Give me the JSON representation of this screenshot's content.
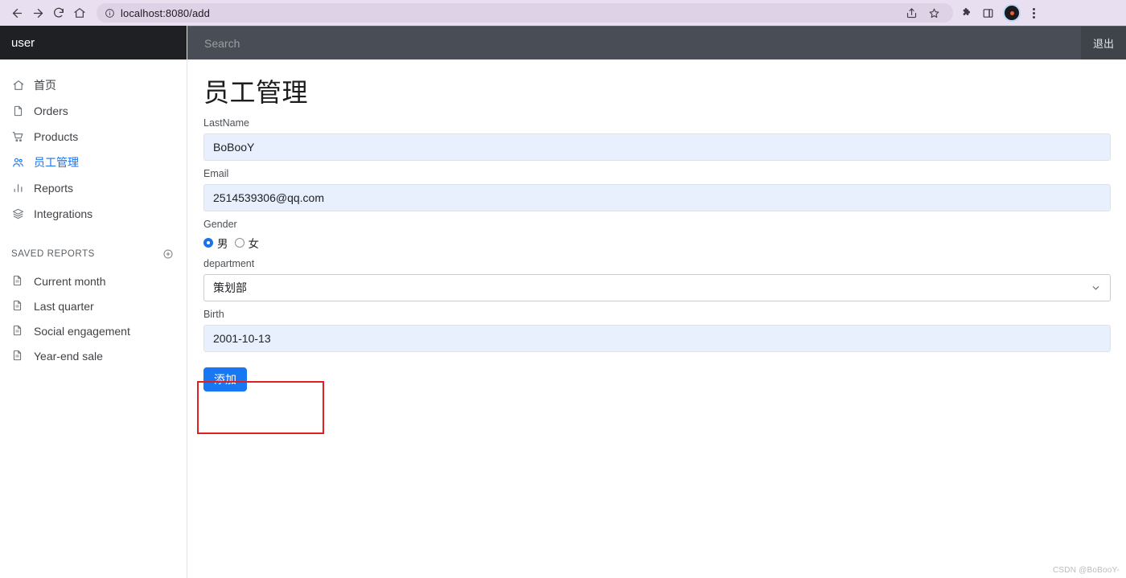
{
  "browser": {
    "url": "localhost:8080/add",
    "back_icon": "back-arrow-icon",
    "forward_icon": "forward-arrow-icon",
    "reload_icon": "reload-icon",
    "home_icon": "home-icon",
    "info_icon": "info-circle-icon",
    "share_icon": "share-icon",
    "bookmark_icon": "star-icon",
    "extensions_icon": "puzzle-icon",
    "sidepanel_icon": "side-panel-icon",
    "profile_icon": "avatar-icon",
    "menu_icon": "kebab-menu-icon"
  },
  "sidebar": {
    "brand": "user",
    "items": [
      {
        "label": "首页",
        "icon": "home-icon",
        "active": false
      },
      {
        "label": "Orders",
        "icon": "document-icon",
        "active": false
      },
      {
        "label": "Products",
        "icon": "cart-icon",
        "active": false
      },
      {
        "label": "员工管理",
        "icon": "people-icon",
        "active": true
      },
      {
        "label": "Reports",
        "icon": "bar-chart-icon",
        "active": false
      },
      {
        "label": "Integrations",
        "icon": "layers-icon",
        "active": false
      }
    ],
    "saved_reports_title": "SAVED REPORTS",
    "add_report_icon": "plus-circle-icon",
    "saved_reports": [
      {
        "label": "Current month",
        "icon": "document-icon"
      },
      {
        "label": "Last quarter",
        "icon": "document-icon"
      },
      {
        "label": "Social engagement",
        "icon": "document-icon"
      },
      {
        "label": "Year-end sale",
        "icon": "document-icon"
      }
    ]
  },
  "navbar": {
    "search_placeholder": "Search",
    "search_value": "",
    "logout_label": "退出"
  },
  "main": {
    "title": "员工管理",
    "fields": {
      "lastname": {
        "label": "LastName",
        "value": "BoBooY",
        "placeholder": ""
      },
      "email": {
        "label": "Email",
        "value": "2514539306@qq.com",
        "placeholder": ""
      },
      "gender": {
        "label": "Gender",
        "options": [
          {
            "label": "男",
            "checked": true
          },
          {
            "label": "女",
            "checked": false
          }
        ]
      },
      "department": {
        "label": "department",
        "value": "策划部"
      },
      "birth": {
        "label": "Birth",
        "value": "2001-10-13",
        "placeholder": ""
      }
    },
    "submit_label": "添加",
    "watermark": "CSDN @BoBooY-"
  },
  "colors": {
    "accent": "#1a73e8",
    "button": "#1877f2",
    "navbar": "#494d55",
    "brand_bar": "#1f2023",
    "input_fill": "#e8f0fe",
    "annotation": "#e02020"
  }
}
